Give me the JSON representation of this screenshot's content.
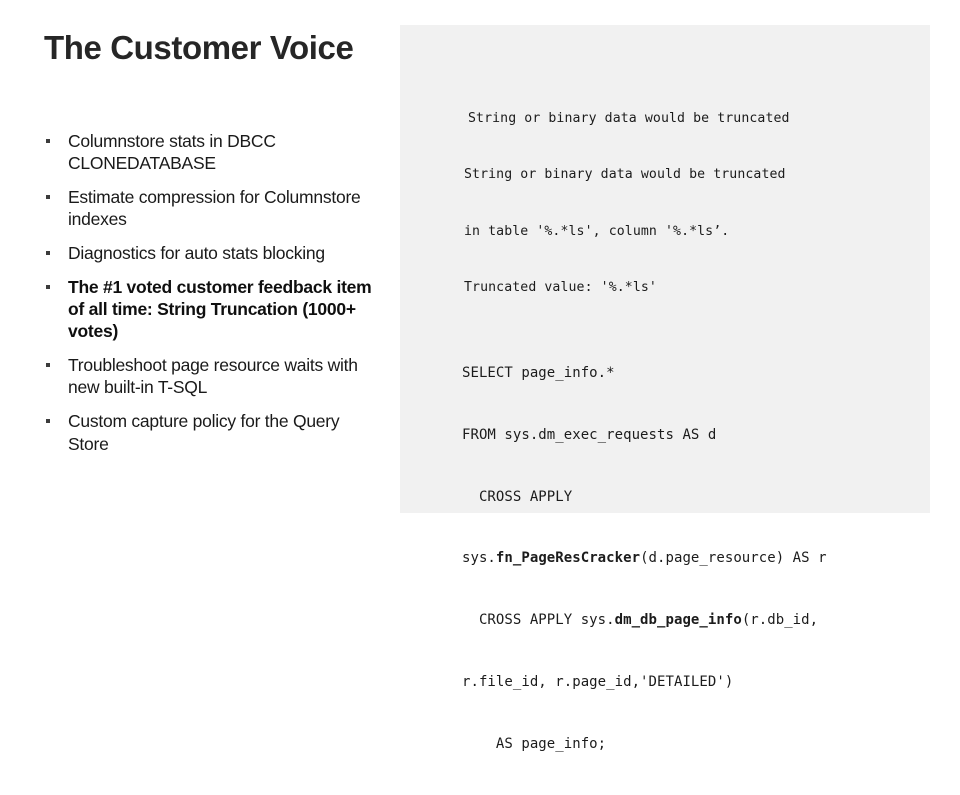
{
  "slide": {
    "title": "The Customer Voice",
    "background_color": "#ffffff",
    "panel_color": "#f1f1f1",
    "title_color": "#262626",
    "text_color": "#1a1a1a"
  },
  "bullets": [
    {
      "text": "Columnstore stats in DBCC CLONEDATABASE",
      "emphasis": false
    },
    {
      "text": "Estimate compression for Columnstore indexes",
      "emphasis": false
    },
    {
      "text": "Diagnostics for auto stats blocking",
      "emphasis": false
    },
    {
      "text": "The #1 voted customer feedback item of all time: String Truncation (1000+ votes)",
      "emphasis": true
    },
    {
      "text": "Troubleshoot page resource waits with new built-in T-SQL",
      "emphasis": false
    },
    {
      "text": "Custom capture policy for the Query Store",
      "emphasis": false
    }
  ],
  "code": {
    "message_short": "String or binary data would be truncated",
    "message_full": {
      "line1": "String or binary data would be truncated",
      "line2": "in table '%.*ls', column '%.*ls’.",
      "line3": "Truncated value: '%.*ls'"
    },
    "sql_query": {
      "line1": "SELECT page_info.*",
      "line2": "FROM sys.dm_exec_requests AS d",
      "line3": "  CROSS APPLY",
      "line4_prefix": "sys.",
      "line4_fn": "fn_PageResCracker",
      "line4_suffix": "(d.page_resource) AS r",
      "line5_prefix": "  CROSS APPLY sys.",
      "line5_fn": "dm_db_page_info",
      "line5_suffix": "(r.db_id,",
      "line6": "r.file_id, r.page_id,'DETAILED')",
      "line7": "    AS page_info;"
    }
  }
}
